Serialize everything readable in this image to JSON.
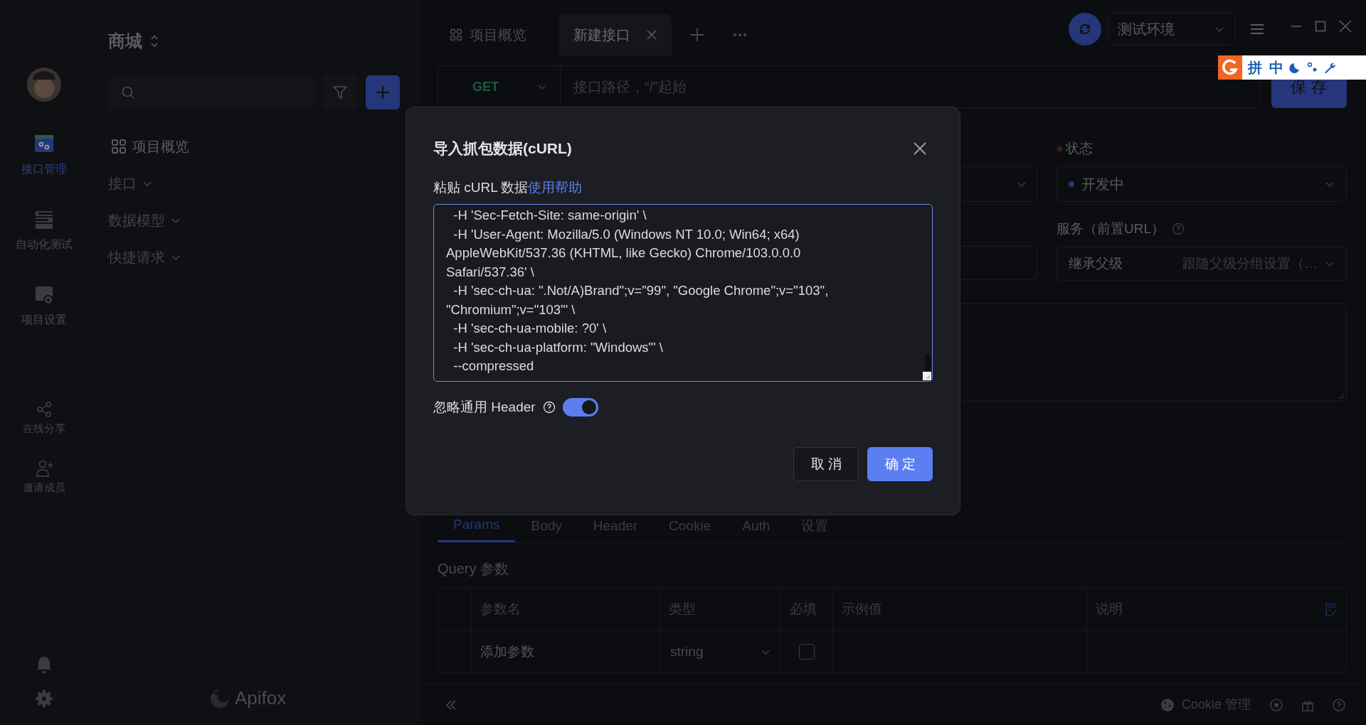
{
  "rail": {
    "items": [
      {
        "label": "接口管理",
        "kind": "api",
        "selected": true
      },
      {
        "label": "自动化测试",
        "kind": "test",
        "selected": false
      },
      {
        "label": "项目设置",
        "kind": "settings",
        "selected": false
      }
    ],
    "extras": [
      {
        "label": "在线分享",
        "kind": "share"
      },
      {
        "label": "邀请成员",
        "kind": "invite"
      }
    ]
  },
  "sidebar": {
    "project": "商城",
    "items": [
      {
        "label": "项目概览",
        "kind": "overview"
      },
      {
        "label": "接口",
        "kind": "group"
      },
      {
        "label": "数据模型",
        "kind": "group"
      },
      {
        "label": "快捷请求",
        "kind": "group"
      }
    ],
    "logo": "Apifox"
  },
  "tabs": [
    {
      "label": "项目概览",
      "selected": false,
      "closable": false
    },
    {
      "label": "新建接口",
      "selected": true,
      "closable": true
    }
  ],
  "environment": "测试环境",
  "request": {
    "method": "GET",
    "path_placeholder": "接口路径，“/”起始",
    "save": "保存"
  },
  "form": {
    "status_label": "状态",
    "status": "开发中",
    "service_label": "服务（前置URL）",
    "service_value": "继承父级",
    "service_hint": "跟随父级分组设置（…"
  },
  "param_tabs": [
    {
      "label": "Params",
      "selected": true
    },
    {
      "label": "Body",
      "selected": false
    },
    {
      "label": "Header",
      "selected": false
    },
    {
      "label": "Cookie",
      "selected": false
    },
    {
      "label": "Auth",
      "selected": false
    },
    {
      "label": "设置",
      "selected": false
    }
  ],
  "query": {
    "title": "Query 参数",
    "columns": [
      "参数名",
      "类型",
      "必填",
      "示例值",
      "说明"
    ],
    "row": {
      "name_placeholder": "添加参数",
      "type": "string",
      "required": false
    }
  },
  "footer": {
    "cookie": "Cookie 管理"
  },
  "ime": {
    "items": [
      "拼",
      "中"
    ]
  },
  "modal": {
    "title": "导入抓包数据(cURL)",
    "label": "粘贴 cURL 数据",
    "help_link": "使用帮助",
    "curl_lines": [
      "  -H 'Sec-Fetch-Site: same-origin' \\",
      "  -H 'User-Agent: Mozilla/5.0 (Windows NT 10.0; Win64; x64) AppleWebKit/537.36 (KHTML, like Gecko) Chrome/103.0.0.0 Safari/537.36' \\",
      "  -H 'sec-ch-ua: \".Not/A)Brand\";v=\"99\", \"Google Chrome\";v=\"103\", \"Chromium\";v=\"103\"' \\",
      "  -H 'sec-ch-ua-mobile: ?0' \\",
      "  -H 'sec-ch-ua-platform: \"Windows\"' \\",
      "  --compressed"
    ],
    "ignore_header": {
      "label": "忽略通用 Header",
      "on": true
    },
    "cancel": "取消",
    "confirm": "确定"
  }
}
